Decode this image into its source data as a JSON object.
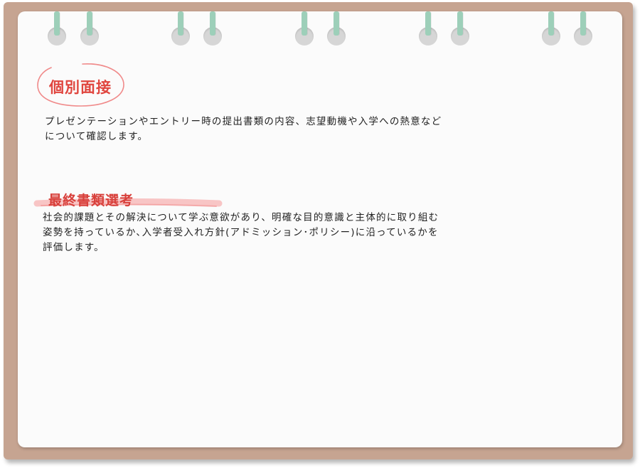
{
  "sections": [
    {
      "heading": "個別面接",
      "body": "プレゼンテーションやエントリー時の提出書類の内容、志望動機や入学への熱意などについて確認します。"
    },
    {
      "heading": "最終書類選考",
      "body": "社会的課題とその解決について学ぶ意欲があり、明確な目的意識と主体的に取り組む姿勢を持っているか､入学者受入れ方針(アドミッション･ポリシー)に沿っているかを評価します。"
    }
  ],
  "colors": {
    "board": "#c6a491",
    "paper": "#fbfbfb",
    "ring": "#9dcfb9",
    "accent_red": "#e0463f"
  }
}
